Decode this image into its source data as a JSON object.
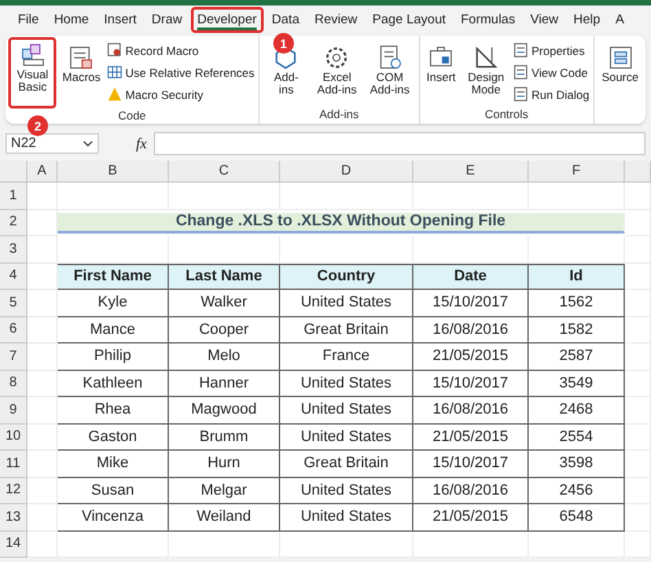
{
  "tabs": [
    {
      "label": "File",
      "selected": false
    },
    {
      "label": "Home",
      "selected": false
    },
    {
      "label": "Insert",
      "selected": false
    },
    {
      "label": "Draw",
      "selected": false
    },
    {
      "label": "Developer",
      "selected": true,
      "marker": "1"
    },
    {
      "label": "Data",
      "selected": false
    },
    {
      "label": "Review",
      "selected": false
    },
    {
      "label": "Page Layout",
      "selected": false
    },
    {
      "label": "Formulas",
      "selected": false
    },
    {
      "label": "View",
      "selected": false
    },
    {
      "label": "Help",
      "selected": false
    },
    {
      "label": "A",
      "selected": false
    }
  ],
  "ribbon_groups": [
    {
      "name": "Code",
      "buttons": [
        {
          "kind": "large",
          "label": "Visual Basic",
          "marker": "2"
        },
        {
          "kind": "large",
          "label": "Macros"
        },
        {
          "kind": "small",
          "label": "Record Macro"
        },
        {
          "kind": "small",
          "label": "Use Relative References"
        },
        {
          "kind": "small",
          "label": "Macro Security"
        }
      ]
    },
    {
      "name": "Add-ins",
      "buttons": [
        {
          "kind": "large",
          "label": "Add-ins"
        },
        {
          "kind": "large",
          "label": "Excel Add-ins"
        },
        {
          "kind": "large",
          "label": "COM Add-ins"
        }
      ]
    },
    {
      "name": "Controls",
      "buttons": [
        {
          "kind": "large",
          "label": "Insert"
        },
        {
          "kind": "large",
          "label": "Design Mode"
        },
        {
          "kind": "small",
          "label": "Properties"
        },
        {
          "kind": "small",
          "label": "View Code"
        },
        {
          "kind": "small",
          "label": "Run Dialog"
        }
      ]
    },
    {
      "buttons": [
        {
          "kind": "large",
          "label": "Source"
        }
      ]
    }
  ],
  "formula_bar": {
    "name_box": "N22",
    "function_label": "fx"
  },
  "sheet": {
    "columns": [
      "A",
      "B",
      "C",
      "D",
      "E",
      "F"
    ],
    "row_numbers": [
      "1",
      "2",
      "3",
      "4",
      "5",
      "6",
      "7",
      "8",
      "9",
      "10",
      "11",
      "12",
      "13",
      "14"
    ],
    "title": "Change .XLS to .XLSX Without Opening File",
    "table": {
      "columns": [
        "First Name",
        "Last Name",
        "Country",
        "Date",
        "Id"
      ],
      "rows": [
        [
          "Kyle",
          "Walker",
          "United States",
          "15/10/2017",
          "1562"
        ],
        [
          "Mance",
          "Cooper",
          "Great Britain",
          "16/08/2016",
          "1582"
        ],
        [
          "Philip",
          "Melo",
          "France",
          "21/05/2015",
          "2587"
        ],
        [
          "Kathleen",
          "Hanner",
          "United States",
          "15/10/2017",
          "3549"
        ],
        [
          "Rhea",
          "Magwood",
          "United States",
          "16/08/2016",
          "2468"
        ],
        [
          "Gaston",
          "Brumm",
          "United States",
          "21/05/2015",
          "2554"
        ],
        [
          "Mike",
          "Hurn",
          "Great Britain",
          "15/10/2017",
          "3598"
        ],
        [
          "Susan",
          "Melgar",
          "United States",
          "16/08/2016",
          "2456"
        ],
        [
          "Vincenza",
          "Weiland",
          "United States",
          "21/05/2015",
          "6548"
        ]
      ]
    }
  }
}
